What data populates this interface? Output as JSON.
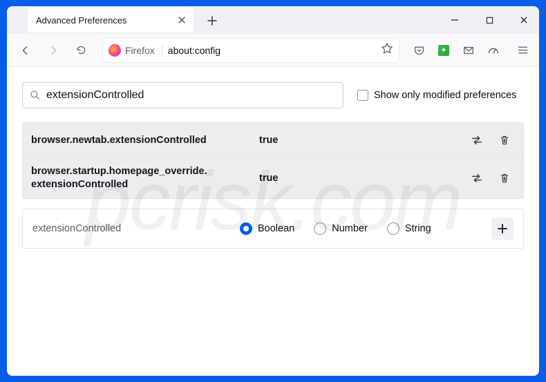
{
  "window": {
    "tab_title": "Advanced Preferences",
    "minimize": "—",
    "maximize": "□",
    "close": "✕"
  },
  "toolbar": {
    "brand": "Firefox",
    "url": "about:config"
  },
  "config": {
    "search_value": "extensionControlled",
    "show_modified_label": "Show only modified preferences",
    "show_modified_checked": false,
    "prefs": [
      {
        "name": "browser.newtab.extensionControlled",
        "value": "true",
        "modified": true
      },
      {
        "name": "browser.startup.homepage_override. extensionControlled",
        "value": "true",
        "modified": true
      }
    ],
    "add": {
      "name": "extensionControlled",
      "types": [
        {
          "label": "Boolean",
          "selected": true
        },
        {
          "label": "Number",
          "selected": false
        },
        {
          "label": "String",
          "selected": false
        }
      ]
    }
  },
  "watermark": "pcrisk.com"
}
